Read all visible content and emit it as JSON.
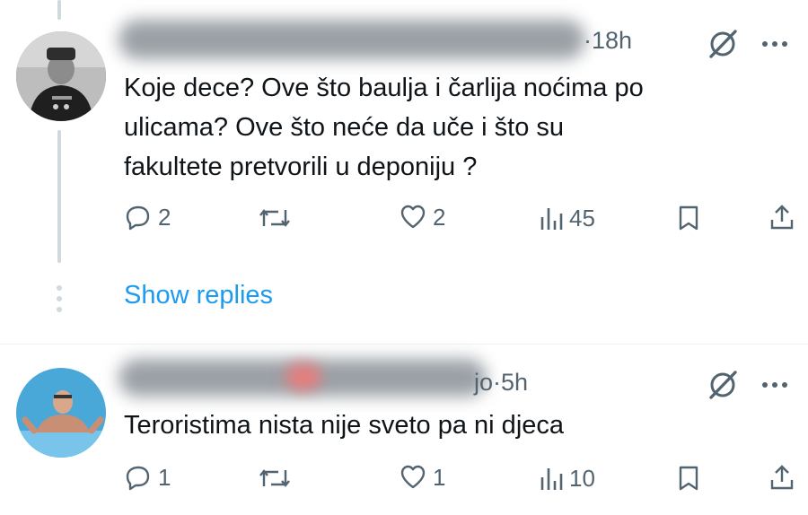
{
  "tweets": [
    {
      "handle_tail": "·18h",
      "text": "Koje dece? Ove što baulja i čarlija noćima po\nulicama? Ove što neće da uče i što su\nfakultete pretvorili u deponiju ?",
      "replies": "2",
      "likes": "2",
      "views": "45"
    },
    {
      "handle_tail": "jo·5h",
      "text": "Teroristima nista nije sveto pa ni djeca",
      "replies": "1",
      "likes": "1",
      "views": "10"
    }
  ],
  "show_replies": "Show replies",
  "icons": {
    "grok": "grok-icon",
    "more": "more-icon",
    "reply": "reply-icon",
    "retweet": "retweet-icon",
    "like": "like-icon",
    "views": "views-icon",
    "bookmark": "bookmark-icon",
    "share": "share-icon"
  },
  "colors": {
    "text": "#0f1419",
    "muted": "#536471",
    "link": "#1d9bf0",
    "thread_line": "#cfd9de"
  }
}
